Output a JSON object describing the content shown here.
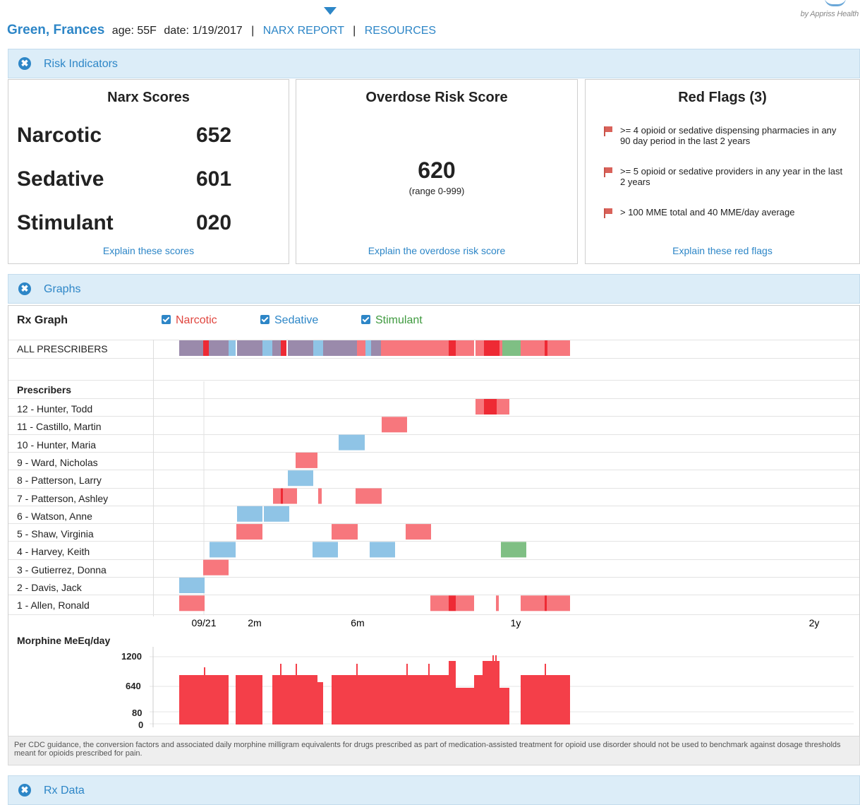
{
  "header": {
    "patient_name": "Green, Frances",
    "age_label": "age: 55F",
    "date_label": "date: 1/19/2017",
    "separator": "|",
    "nav_narx": "NARX REPORT",
    "nav_resources": "RESOURCES",
    "brand": "by Appriss Health"
  },
  "risk": {
    "title": "Risk Indicators",
    "narx": {
      "title": "Narx Scores",
      "rows": [
        {
          "label": "Narcotic",
          "value": "652"
        },
        {
          "label": "Sedative",
          "value": "601"
        },
        {
          "label": "Stimulant",
          "value": "020"
        }
      ],
      "link": "Explain these scores"
    },
    "overdose": {
      "title": "Overdose Risk Score",
      "value": "620",
      "range": "(range 0-999)",
      "link": "Explain the overdose risk score"
    },
    "flags": {
      "title": "Red Flags (3)",
      "items": [
        ">= 4 opioid or sedative dispensing pharmacies in any 90 day period in the last 2 years",
        ">= 5 opioid or sedative providers in any year in the last 2 years",
        "> 100 MME total and 40 MME/day average"
      ],
      "link": "Explain these red flags"
    }
  },
  "graphs": {
    "title": "Graphs",
    "rx_graph_label": "Rx Graph",
    "legend": [
      {
        "label": "Narcotic",
        "color": "#e0463f"
      },
      {
        "label": "Sedative",
        "color": "#2d86c7"
      },
      {
        "label": "Stimulant",
        "color": "#3f9a3f"
      }
    ],
    "all_prescribers_label": "ALL PRESCRIBERS",
    "prescribers_header": "Prescribers",
    "prescribers": [
      "12 - Hunter, Todd",
      "11 - Castillo, Martin",
      "10 - Hunter, Maria",
      "9 - Ward, Nicholas",
      "8 - Patterson, Larry",
      "7 - Patterson, Ashley",
      "6 - Watson, Anne",
      "5 - Shaw, Virginia",
      "4 - Harvey, Keith",
      "3 - Gutierrez, Donna",
      "2 - Davis, Jack",
      "1 - Allen, Ronald"
    ],
    "time_axis": [
      "09/21",
      "2m",
      "6m",
      "1y",
      "2y"
    ],
    "mme_title": "Morphine MeEq/day",
    "mme_ticks": [
      "1200",
      "640",
      "80",
      "0"
    ],
    "cdc_note": "Per CDC guidance, the conversion factors and associated daily morphine milligram equivalents for drugs prescribed as part of medication-assisted treatment for opioid use disorder should not be used to benchmark against dosage thresholds meant for opioids prescribed for pain."
  },
  "rx_data": {
    "title": "Rx Data"
  },
  "colors": {
    "narcotic_bar": "#f7777d",
    "sedative_bar": "#8fc4e6",
    "stimulant_bar": "#7fbf84",
    "overlap_bar": "#9a8aab",
    "mme_fill": "#f43f49",
    "accent": "#2d86c7"
  }
}
